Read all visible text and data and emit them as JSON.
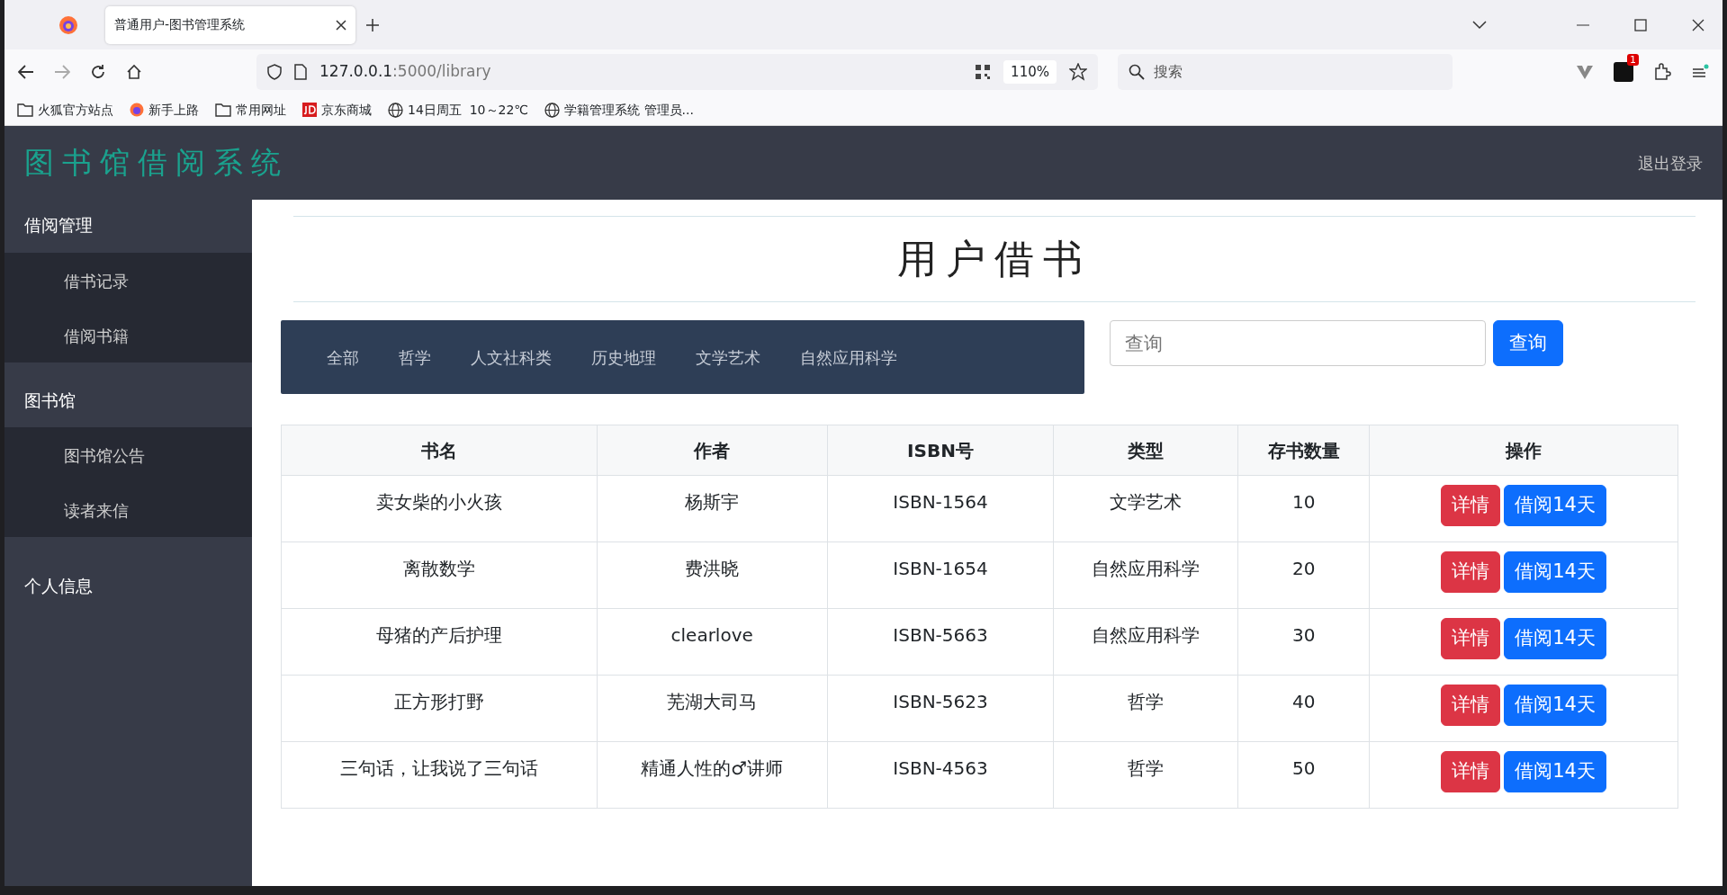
{
  "browser": {
    "tab_title": "普通用户-图书管理系统",
    "url_host": "127.0.0.1",
    "url_path": ":5000/library",
    "zoom": "110%",
    "search": {
      "placeholder": "搜索"
    },
    "extension_badge": "1",
    "bookmarks": [
      {
        "label": "火狐官方站点",
        "kind": "folder"
      },
      {
        "label": "新手上路",
        "kind": "firefox"
      },
      {
        "label": "常用网址",
        "kind": "folder"
      },
      {
        "label": "京东商城",
        "kind": "jd"
      },
      {
        "label": "14日周五  10～22℃",
        "kind": "globe"
      },
      {
        "label": "学籍管理系统 管理员...",
        "kind": "globe"
      }
    ]
  },
  "header": {
    "title": "图书馆借阅系统",
    "logout": "退出登录"
  },
  "sidebar": {
    "items": [
      {
        "label": "借阅管理",
        "children": [
          {
            "label": "借书记录"
          },
          {
            "label": "借阅书籍"
          }
        ]
      },
      {
        "label": "图书馆",
        "children": [
          {
            "label": "图书馆公告"
          },
          {
            "label": "读者来信"
          }
        ]
      },
      {
        "label": "个人信息"
      }
    ]
  },
  "page_title": "用户借书",
  "categories": [
    {
      "label": "全部",
      "selected": false
    },
    {
      "label": "哲学",
      "selected": false
    },
    {
      "label": "人文社科类",
      "selected": false
    },
    {
      "label": "历史地理",
      "selected": false
    },
    {
      "label": "文学艺术",
      "selected": false
    },
    {
      "label": "自然应用科学",
      "selected": false
    }
  ],
  "search": {
    "placeholder": "查询",
    "button": "查询"
  },
  "table": {
    "columns": [
      "书名",
      "作者",
      "ISBN号",
      "类型",
      "存书数量",
      "操作"
    ],
    "rows": [
      {
        "cells": [
          "卖女柴的小火孩",
          "杨斯宇",
          "ISBN-1564",
          "文学艺术",
          "10"
        ],
        "actions": [
          "详情",
          "借阅14天"
        ]
      },
      {
        "cells": [
          "离散数学",
          "费洪晓",
          "ISBN-1654",
          "自然应用科学",
          "20"
        ],
        "actions": [
          "详情",
          "借阅14天"
        ]
      },
      {
        "cells": [
          "母猪的产后护理",
          "clearlove",
          "ISBN-5663",
          "自然应用科学",
          "30"
        ],
        "actions": [
          "详情",
          "借阅14天"
        ]
      },
      {
        "cells": [
          "正方形打野",
          "芜湖大司马",
          "ISBN-5623",
          "哲学",
          "40"
        ],
        "actions": [
          "详情",
          "借阅14天"
        ]
      },
      {
        "cells": [
          "三句话，让我说了三句话",
          "精通人性的♂讲师",
          "ISBN-4563",
          "哲学",
          "50"
        ],
        "actions": [
          "详情",
          "借阅14天"
        ]
      }
    ]
  }
}
